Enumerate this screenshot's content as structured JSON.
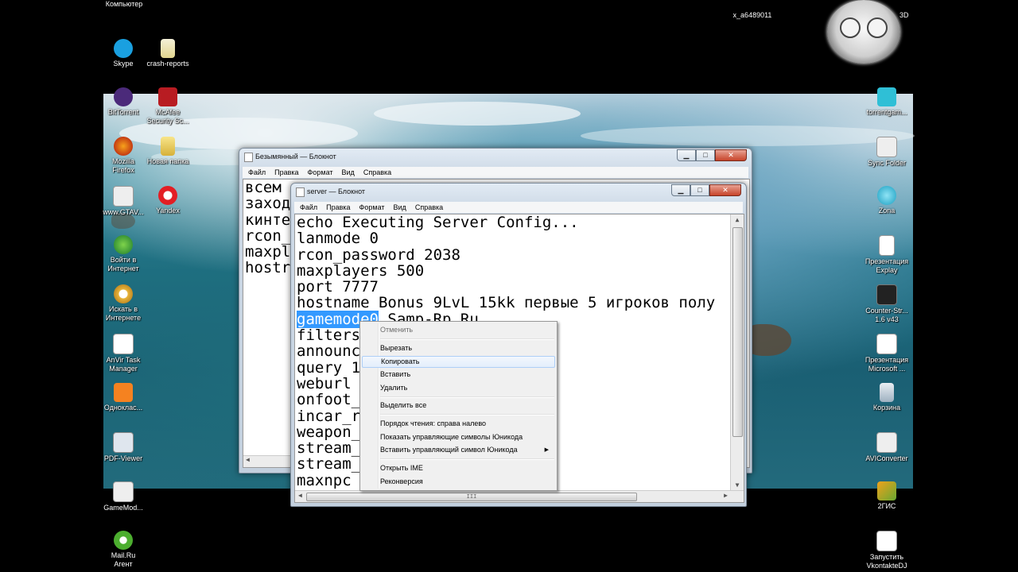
{
  "desktop": {
    "top_label_computer": "Компьютер",
    "top_label_user": "x_a6489011",
    "corner_text": "3D",
    "left_icons": [
      {
        "label": "Skype",
        "icon": "skype-icon"
      },
      {
        "label": "BitTorrent",
        "icon": "bittorrent-icon"
      },
      {
        "label": "Mozilla\nFirefox",
        "icon": "firefox-icon"
      },
      {
        "label": "www.GTAV...",
        "icon": "shortcut-icon"
      },
      {
        "label": "Войти в\nИнтернет",
        "icon": "internet-login-icon"
      },
      {
        "label": "Искать в\nИнтернете",
        "icon": "search-internet-icon"
      },
      {
        "label": "AnVir Task\nManager",
        "icon": "anvir-icon"
      },
      {
        "label": "Одноклас...",
        "icon": "odnoklassniki-icon"
      },
      {
        "label": "PDF-Viewer",
        "icon": "pdf-icon"
      },
      {
        "label": "GameMod...",
        "icon": "shortcut-icon"
      },
      {
        "label": "Mail.Ru\nАгент",
        "icon": "mailru-agent-icon"
      }
    ],
    "second_col_icons": [
      {
        "label": "crash-reports",
        "icon": "folder-icon"
      },
      {
        "label": "McAfee\nSecurity Sc...",
        "icon": "mcafee-icon"
      },
      {
        "label": "Новая папка",
        "icon": "folder-icon"
      },
      {
        "label": "Yandex",
        "icon": "yandex-icon"
      }
    ],
    "right_icons": [
      {
        "label": "torrentgam...",
        "icon": "zona-file-icon"
      },
      {
        "label": "Sync Folder",
        "icon": "sync-icon"
      },
      {
        "label": "Zona",
        "icon": "zona-icon"
      },
      {
        "label": "Презентация\nExplay",
        "icon": "document-icon"
      },
      {
        "label": "Counter-Str...\n1.6 v43",
        "icon": "counter-strike-icon"
      },
      {
        "label": "Презентация\nMicrosoft ...",
        "icon": "document-icon"
      },
      {
        "label": "Корзина",
        "icon": "recycle-bin-icon"
      },
      {
        "label": "AVIConverter",
        "icon": "aviconverter-icon"
      },
      {
        "label": "2ГИС",
        "icon": "2gis-icon"
      },
      {
        "label": "Запустить\nVkontakteDJ",
        "icon": "vkontaktedj-icon"
      }
    ]
  },
  "back_window": {
    "title": "Безымянный — Блокнот",
    "menu": [
      "Файл",
      "Правка",
      "Формат",
      "Вид",
      "Справка"
    ],
    "lines": [
      "всем",
      "заход",
      "кинте",
      "rcon_",
      "maxpl",
      "hostr"
    ]
  },
  "front_window": {
    "title": "server — Блокнот",
    "menu": [
      "Файл",
      "Правка",
      "Формат",
      "Вид",
      "Справка"
    ],
    "lines": [
      "echo Executing Server Config...",
      "lanmode 0",
      "rcon_password 2038",
      "maxplayers 500",
      "port 7777",
      "hostname Bonus 9LvL 15kk первые 5 игроков полу"
    ],
    "selected_text": "gamemode0",
    "after_selection": " Samp-Rp.Ru",
    "lines_after": [
      "filters",
      "announc",
      "query 1",
      "weburl",
      "onfoot_",
      "incar_r",
      "weapon_",
      "stream_",
      "stream_",
      "maxnpc"
    ],
    "hscroll_grip": "III"
  },
  "context_menu": {
    "items": [
      {
        "label": "Отменить"
      },
      {
        "label": "Вырезать"
      },
      {
        "label": "Копировать"
      },
      {
        "label": "Вставить"
      },
      {
        "label": "Удалить"
      },
      {
        "label": "Выделить все"
      },
      {
        "label": "Порядок чтения: справа налево"
      },
      {
        "label": "Показать управляющие символы Юникода"
      },
      {
        "label": "Вставить управляющий символ Юникода"
      },
      {
        "label": "Открыть IME"
      },
      {
        "label": "Реконверсия"
      }
    ],
    "highlighted": "Копировать"
  }
}
